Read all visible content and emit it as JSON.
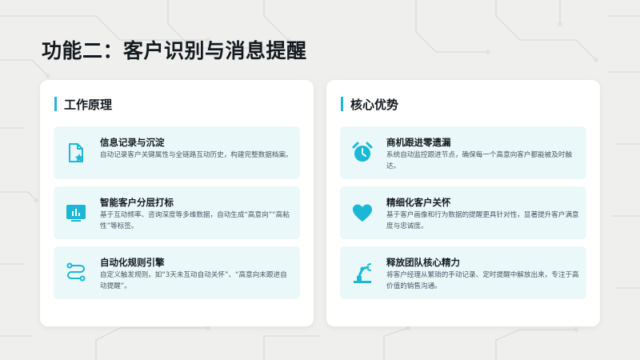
{
  "title": "功能二：客户识别与消息提醒",
  "left_card": {
    "heading": "工作原理",
    "items": [
      {
        "title": "信息记录与沉淀",
        "desc": "自动记录客户关键属性与全链路互动历史，构建完整数据档案。",
        "icon": "document-star-icon"
      },
      {
        "title": "智能客户分层打标",
        "desc": "基于互动频率、咨询深度等多维数据，自动生成“高意向”“高粘性”等标签。",
        "icon": "bar-chart-icon"
      },
      {
        "title": "自动化规则引擎",
        "desc": "自定义触发规则，如“3天未互动自动关怀”、“高意向未跟进自动提醒”。",
        "icon": "workflow-icon"
      }
    ]
  },
  "right_card": {
    "heading": "核心优势",
    "items": [
      {
        "title": "商机跟进零遗漏",
        "desc": "系统自动监控跟进节点，确保每一个高意向客户都能被及时触达。",
        "icon": "alarm-clock-icon"
      },
      {
        "title": "精细化客户关怀",
        "desc": "基于客户画像和行为数据的提醒更具针对性，显著提升客户满意度与忠诚度。",
        "icon": "heart-icon"
      },
      {
        "title": "释放团队核心精力",
        "desc": "将客户经理从繁琐的手动记录、定时提醒中解放出来，专注于高价值的销售沟通。",
        "icon": "robot-arm-icon"
      }
    ]
  },
  "colors": {
    "accent": "#1bb8d6",
    "item_bg": "#eaf8fa",
    "page_bg": "#efefee"
  }
}
